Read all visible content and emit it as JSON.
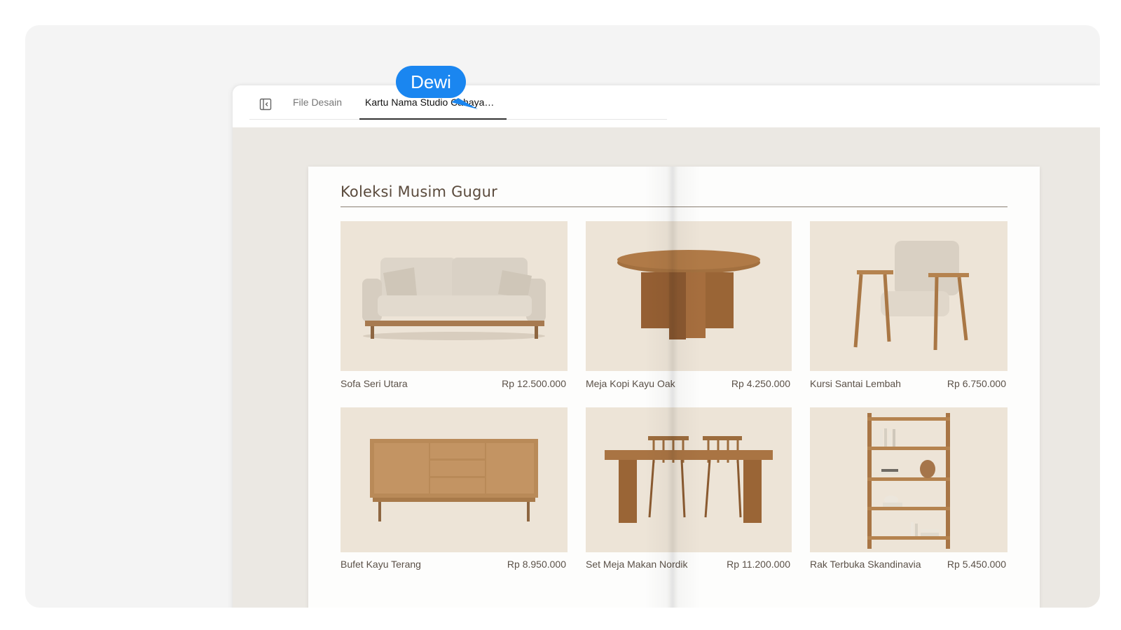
{
  "tabs": {
    "file_label": "File Desain",
    "active_label": "Kartu Nama Studio Cahaya…"
  },
  "catalog": {
    "title": "Koleksi Musim Gugur",
    "items": [
      {
        "name": "Sofa Seri Utara",
        "price": "Rp 12.500.000",
        "icon": "sofa-image"
      },
      {
        "name": "Meja Kopi Kayu Oak",
        "price": "Rp 4.250.000",
        "icon": "coffee-table-image"
      },
      {
        "name": "Kursi Santai Lembah",
        "price": "Rp 6.750.000",
        "icon": "armchair-image"
      },
      {
        "name": "Bufet Kayu Terang",
        "price": "Rp 8.950.000",
        "icon": "sideboard-image"
      },
      {
        "name": "Set Meja Makan Nordik",
        "price": "Rp 11.200.000",
        "icon": "dining-set-image"
      },
      {
        "name": "Rak Terbuka Skandinavia",
        "price": "Rp 5.450.000",
        "icon": "shelf-image"
      }
    ]
  },
  "collaborator": {
    "name": "Dewi",
    "color": "#1a86f0"
  }
}
